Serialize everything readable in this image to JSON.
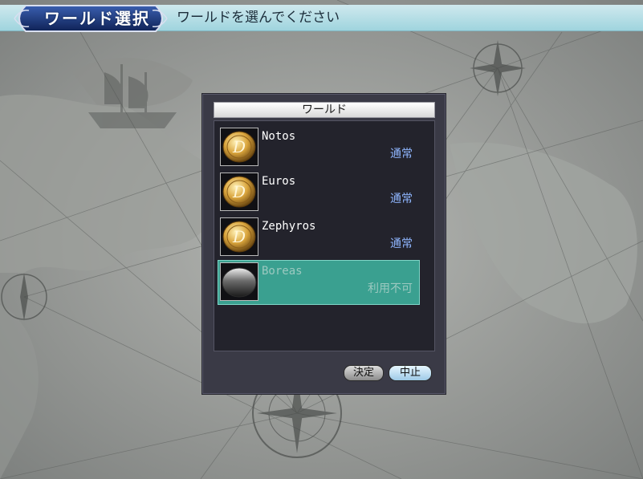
{
  "header": {
    "title": "ワールド選択",
    "instruction": "ワールドを選んでください"
  },
  "dialog": {
    "title": "ワールド",
    "worlds": [
      {
        "name": "Notos",
        "status": "通常",
        "available": true
      },
      {
        "name": "Euros",
        "status": "通常",
        "available": true
      },
      {
        "name": "Zephyros",
        "status": "通常",
        "available": true
      },
      {
        "name": "Boreas",
        "status": "利用不可",
        "available": false
      }
    ],
    "buttons": {
      "confirm": "決定",
      "cancel": "中止"
    }
  },
  "colors": {
    "header_bar": "#a7d8e2",
    "status_normal": "#8fb6ff",
    "unavailable_highlight": "#3aa090"
  }
}
